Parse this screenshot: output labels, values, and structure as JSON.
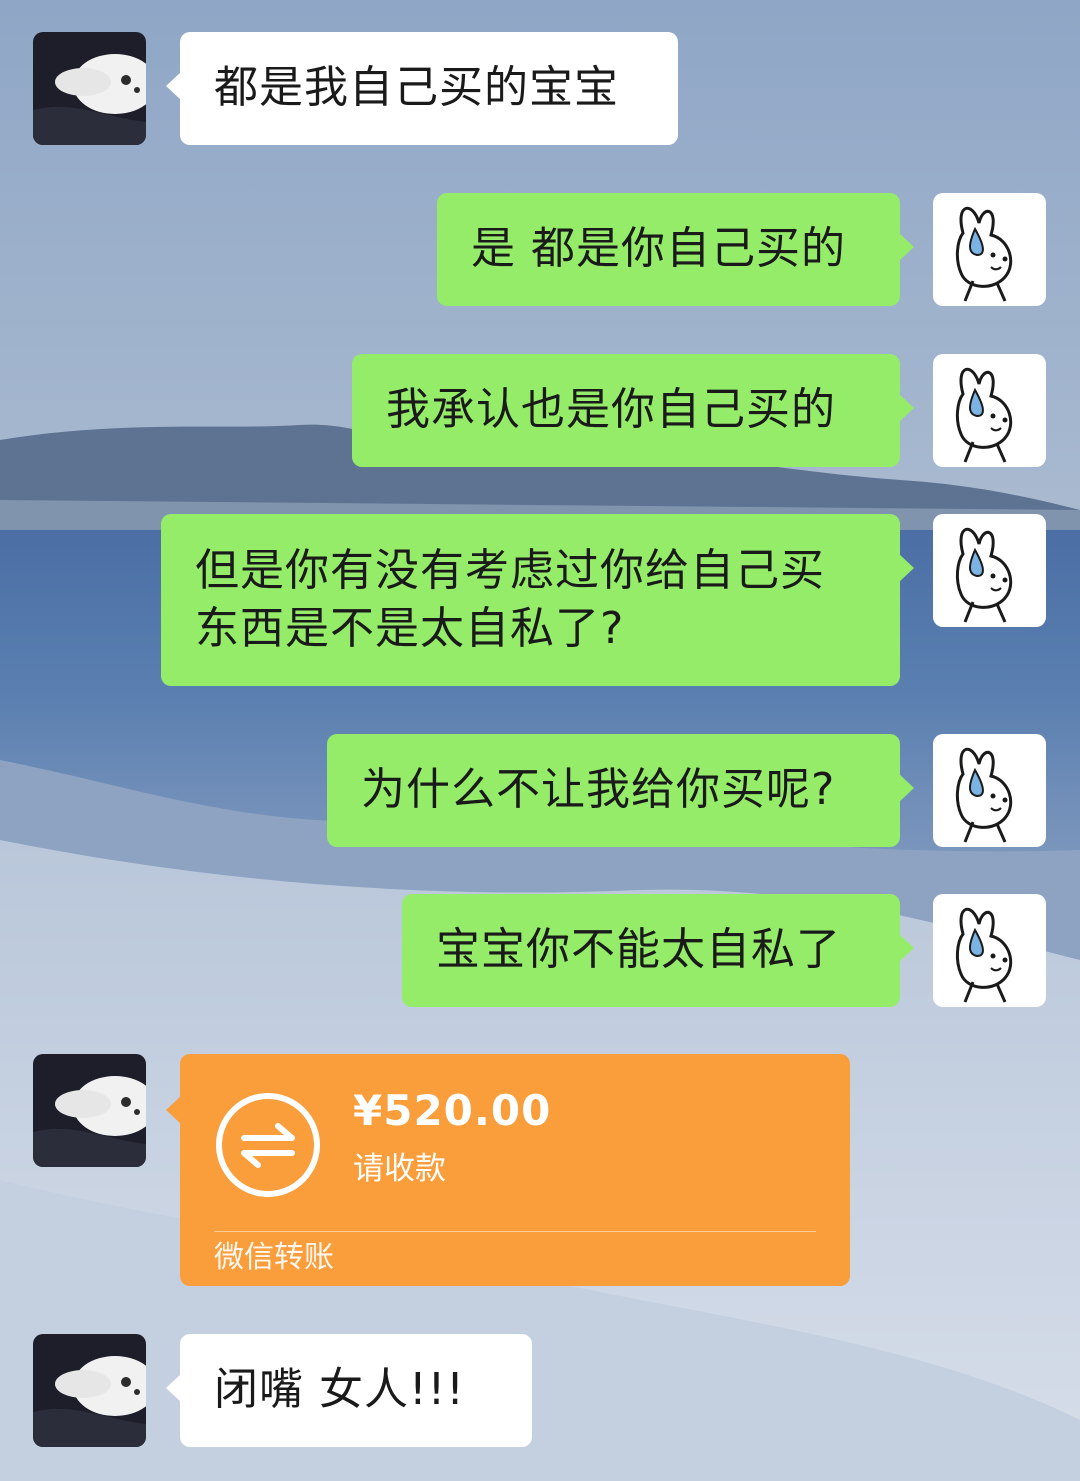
{
  "messages": [
    {
      "side": "left",
      "text": "都是我自己买的宝宝"
    },
    {
      "side": "right",
      "text": "是 都是你自己买的"
    },
    {
      "side": "right",
      "text": "我承认也是你自己买的"
    },
    {
      "side": "right",
      "lines": [
        "但是你有没有考虑过你给自己买",
        "东西是不是太自私了?"
      ]
    },
    {
      "side": "right",
      "text": "为什么不让我给你买呢?"
    },
    {
      "side": "right",
      "text": "宝宝你不能太自私了"
    },
    {
      "side": "left",
      "type": "transfer",
      "amount": "¥520.00",
      "status": "请收款",
      "footer": "微信转账"
    },
    {
      "side": "left",
      "text": "闭嘴 女人!!!"
    }
  ],
  "colors": {
    "sent_bubble": "#95ec69",
    "received_bubble": "#ffffff",
    "transfer_card": "#fa9d3b"
  },
  "icons": {
    "transfer": "transfer-arrows-icon",
    "self_avatar": "bunny-sweat-avatar",
    "other_avatar": "white-cat-avatar"
  }
}
